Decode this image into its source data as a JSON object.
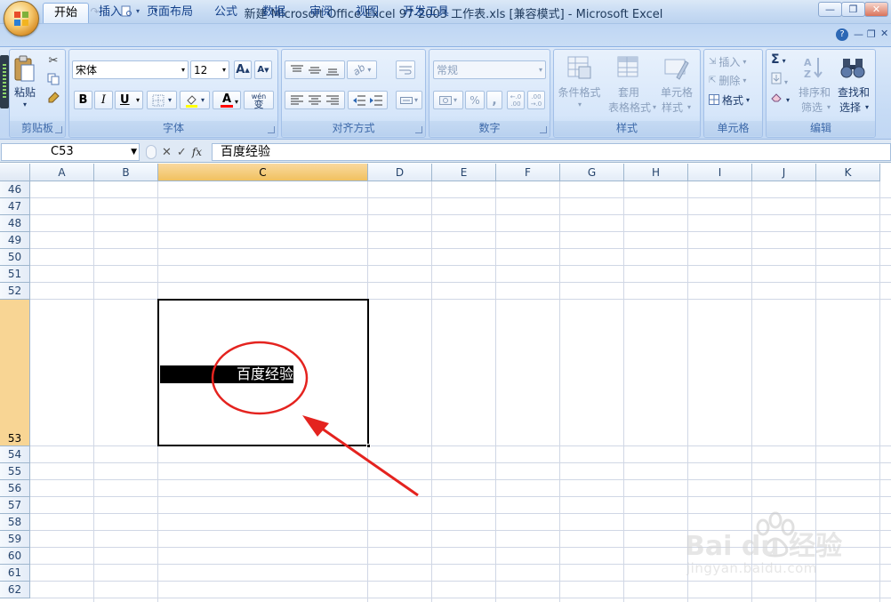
{
  "window": {
    "title": "新建 Microsoft Office Excel 97-2003 工作表.xls  [兼容模式] - Microsoft Excel",
    "minimize": "—",
    "restore": "❐",
    "close": "✕"
  },
  "tabs": [
    "开始",
    "插入",
    "页面布局",
    "公式",
    "数据",
    "审阅",
    "视图",
    "开发工具"
  ],
  "ribbon": {
    "clipboard": {
      "label": "剪贴板",
      "paste": "粘贴"
    },
    "font": {
      "label": "字体",
      "font_name": "宋体",
      "font_size": "12",
      "bold": "B",
      "italic": "I",
      "underline": "U",
      "grow": "A",
      "shrink": "A",
      "font_color": "A",
      "phonetic": "wén"
    },
    "alignment": {
      "label": "对齐方式"
    },
    "number": {
      "label": "数字",
      "format": "常规",
      "percent": "%",
      "comma": ","
    },
    "styles": {
      "label": "样式",
      "conditional": "条件格式",
      "table_format_1": "套用",
      "table_format_2": "表格格式",
      "cell_style_1": "单元格",
      "cell_style_2": "样式"
    },
    "cells": {
      "label": "单元格",
      "insert": "插入",
      "delete": "删除",
      "format": "格式"
    },
    "editing": {
      "label": "编辑",
      "sort_1": "排序和",
      "sort_2": "筛选",
      "find_1": "查找和",
      "find_2": "选择"
    }
  },
  "formula_bar": {
    "name_box": "C53",
    "fx": "fx",
    "content": "百度经验"
  },
  "grid": {
    "columns": [
      "A",
      "B",
      "C",
      "D",
      "E",
      "F",
      "G",
      "H",
      "I",
      "J",
      "K"
    ],
    "rows": [
      "46",
      "47",
      "48",
      "49",
      "50",
      "51",
      "52",
      "53",
      "54",
      "55",
      "56",
      "57",
      "58",
      "59",
      "60",
      "61",
      "62"
    ],
    "selected_column": "C",
    "selected_row": "53",
    "cell_text": "百度经验"
  },
  "watermark": {
    "brand": "Bai du 经验",
    "url": "jingyan.baidu.com"
  },
  "colors": {
    "annotation": "#e4231f",
    "accent": "#15428b",
    "selection": "#f1c15f"
  }
}
